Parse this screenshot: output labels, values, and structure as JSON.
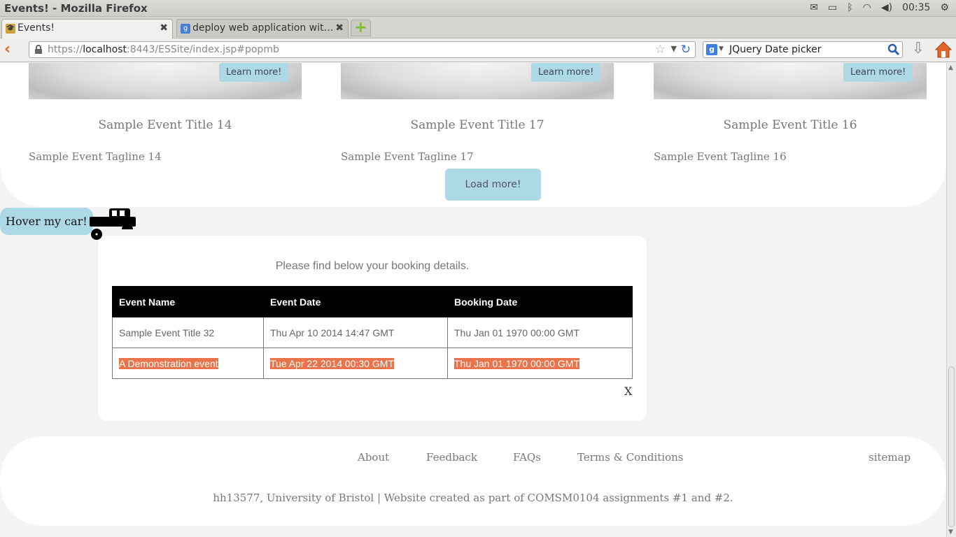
{
  "window": {
    "title": "Events! - Mozilla Firefox"
  },
  "panel": {
    "clock": "00:35"
  },
  "tabs": [
    {
      "label": "Events!",
      "active": true
    },
    {
      "label": "deploy web application wit…",
      "active": false
    }
  ],
  "navbar": {
    "url_prefix": "https://",
    "url_host": "localhost",
    "url_rest": ":8443/ESSite/index.jsp#popmb",
    "search_value": "JQuery Date picker"
  },
  "events": [
    {
      "title": "Sample Event Title 14",
      "tagline": "Sample Event Tagline 14",
      "button": "Learn more!"
    },
    {
      "title": "Sample Event Title 17",
      "tagline": "Sample Event Tagline 17",
      "button": "Learn more!"
    },
    {
      "title": "Sample Event Title 16",
      "tagline": "Sample Event Tagline 16",
      "button": "Learn more!"
    }
  ],
  "load_more": "Load more!",
  "hover_car": "Hover my car!",
  "booking": {
    "message": "Please find below your booking details.",
    "headers": [
      "Event Name",
      "Event Date",
      "Booking Date"
    ],
    "rows": [
      [
        "Sample Event Title 32",
        "Thu Apr 10 2014 14:47 GMT",
        "Thu Jan 01 1970 00:00 GMT"
      ],
      [
        "A Demonstration event",
        "Tue Apr 22 2014 00:30 GMT",
        "Thu Jan 01 1970 00:00 GMT"
      ]
    ],
    "close": "X"
  },
  "footer": {
    "links": [
      "About",
      "Feedback",
      "FAQs",
      "Terms & Conditions",
      "sitemap"
    ],
    "copyright": "hh13577, University of Bristol | Website created as part of COMSM0104 assignments #1 and #2."
  },
  "colors": {
    "accent": "#add8e6",
    "highlight": "#e9734a",
    "firefox_orange": "#e0662b"
  }
}
